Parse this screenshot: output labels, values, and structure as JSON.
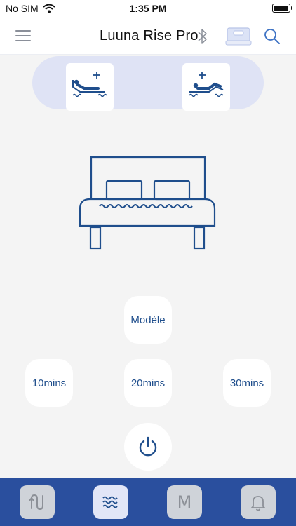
{
  "status_bar": {
    "carrier": "No SIM",
    "time": "1:35 PM",
    "wifi_icon": "wifi-icon",
    "battery_icon": "battery-icon"
  },
  "header": {
    "title": "Luuna Rise Pro",
    "menu_icon": "hamburger-menu-icon",
    "bluetooth_icon": "bluetooth-icon",
    "device_icon": "bed-device-icon",
    "search_icon": "search-icon"
  },
  "positions": {
    "head_up_icon": "head-raise-icon",
    "foot_up_icon": "foot-raise-icon"
  },
  "controls": {
    "model_label": "Modèle",
    "timers": [
      "10mins",
      "20mins",
      "30mins"
    ],
    "power_icon": "power-icon"
  },
  "tabbar": {
    "tabs": [
      {
        "icon": "position-tab-icon",
        "active": false
      },
      {
        "icon": "massage-tab-icon",
        "active": true
      },
      {
        "icon": "memory-tab-icon",
        "label": "M",
        "active": false
      },
      {
        "icon": "alarm-tab-icon",
        "active": false
      }
    ]
  },
  "colors": {
    "accent": "#1f4e8c",
    "tabbar": "#2a4f9e",
    "pill": "#dfe3f5",
    "background": "#f4f4f4"
  }
}
